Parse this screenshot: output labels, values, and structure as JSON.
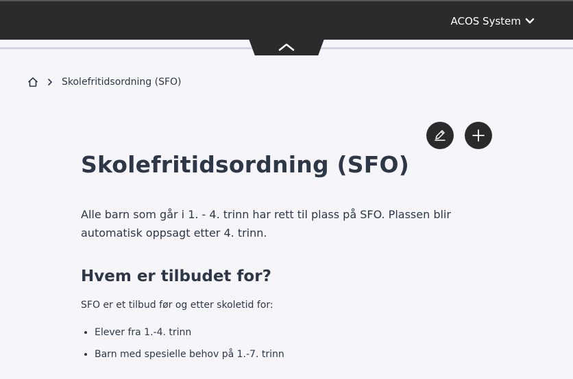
{
  "header": {
    "system_label": "ACOS System",
    "menu_icon": "chevron-down-icon",
    "collapse_icon": "chevron-up-icon"
  },
  "breadcrumb": {
    "home_icon": "home-icon",
    "separator_icon": "chevron-right-icon",
    "current": "Skolefritidsordning (SFO)"
  },
  "actions": {
    "edit_icon": "pencil-icon",
    "add_icon": "plus-icon"
  },
  "main": {
    "title": "Skolefritidsordning (SFO)",
    "intro": "Alle barn som går i 1. - 4. trinn har rett til plass på SFO. Plassen blir automatisk oppsagt etter 4. trinn.",
    "section_title": "Hvem er tilbudet for?",
    "section_text": "SFO er et tilbud før og etter skoletid for:",
    "list_items": [
      "Elever fra 1.-4. trinn",
      "Barn med spesielle behov på 1.-7. trinn"
    ]
  },
  "colors": {
    "topbar": "#2b2b2b",
    "background": "#f6f6fa",
    "text": "#2d3748",
    "divider": "#d4d4e4"
  }
}
